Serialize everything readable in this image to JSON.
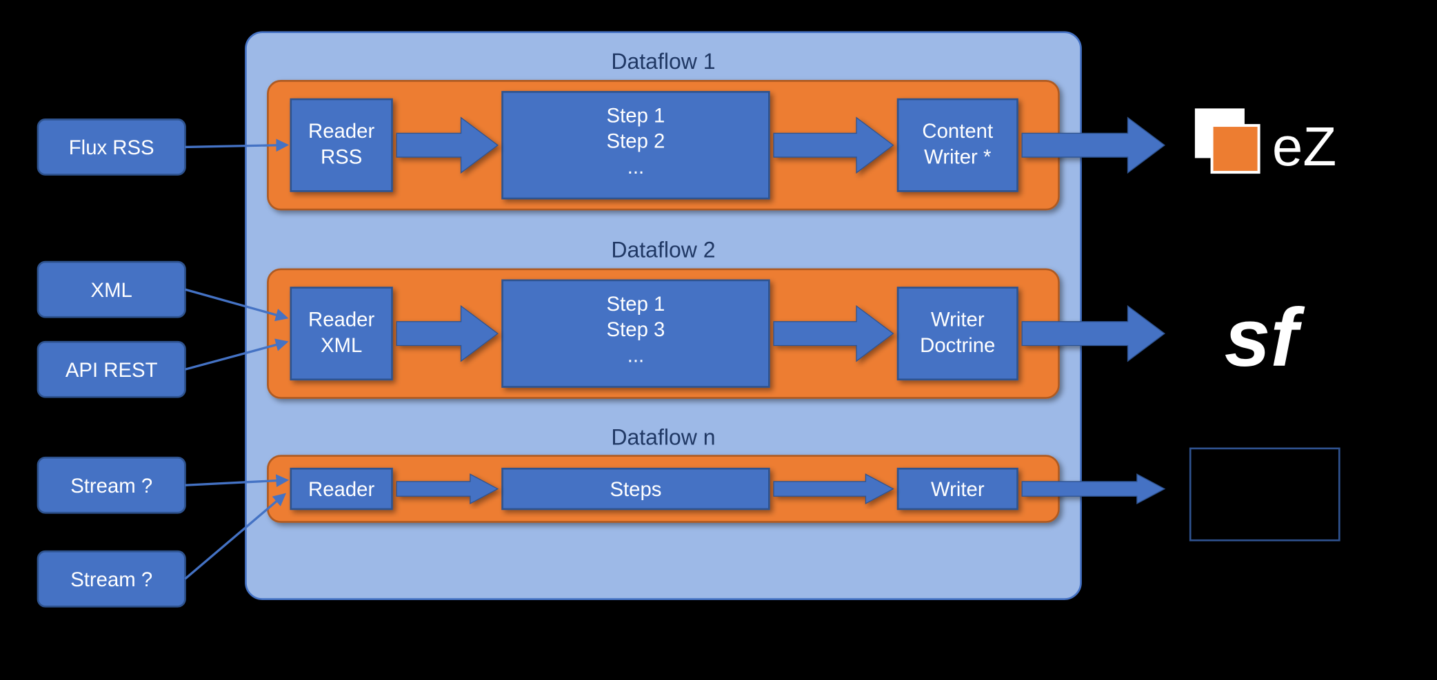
{
  "inputs": {
    "fluxrss": "Flux RSS",
    "xml": "XML",
    "apirest": "API REST",
    "stream1": "Stream ?",
    "stream2": "Stream ?"
  },
  "dataflows": {
    "df1": {
      "title": "Dataflow 1",
      "reader": "Reader RSS",
      "steps": "Step 1\nStep 2\n...",
      "writer": "Content Writer *"
    },
    "df2": {
      "title": "Dataflow 2",
      "reader": "Reader XML",
      "steps": "Step 1\nStep 3\n...",
      "writer": "Writer Doctrine"
    },
    "dfn": {
      "title": "Dataflow n",
      "reader": "Reader",
      "steps": "Steps",
      "writer": "Writer"
    }
  },
  "outputs": {
    "ez": "eZ",
    "sf": "sf"
  },
  "colors": {
    "lightblue": "#9DB9E7",
    "blue": "#4472C4",
    "orange": "#ED7D31",
    "darkblue": "#2F528F",
    "text_dark": "#203864",
    "white": "#FFFFFF",
    "black": "#000000"
  }
}
